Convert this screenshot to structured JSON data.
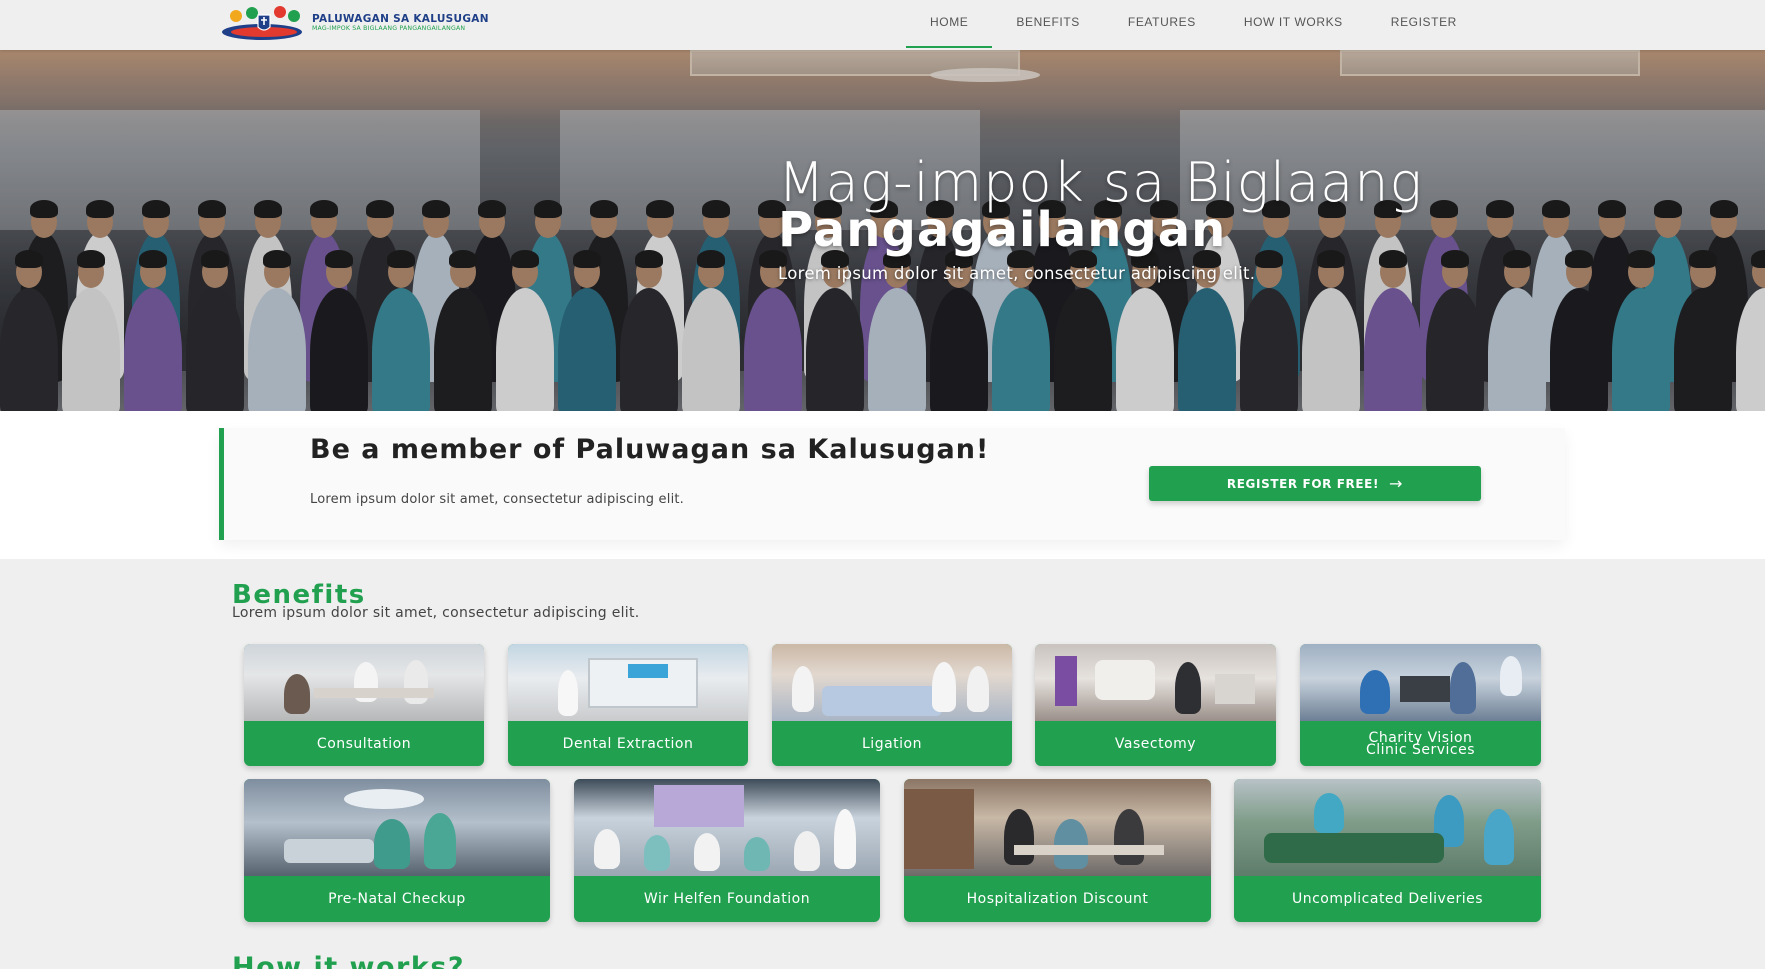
{
  "brand": {
    "name": "PALUWAGAN SA KALUSUGAN",
    "tagline": "MAG-IMPOK SA BIGLAANG PANGANGAILANGAN",
    "primary_color": "#21a04f",
    "dark_blue": "#1f3f88"
  },
  "nav": {
    "items": [
      {
        "label": "HOME",
        "active": true
      },
      {
        "label": "BENEFITS",
        "active": false
      },
      {
        "label": "FEATURES",
        "active": false
      },
      {
        "label": "HOW IT WORKS",
        "active": false
      },
      {
        "label": "REGISTER",
        "active": false
      }
    ]
  },
  "hero": {
    "title_line1": "Mag-impok sa Biglaang",
    "title_line2": "Pangagailangan",
    "subtitle": "Lorem ipsum dolor sit amet, consectetur adipiscing elit."
  },
  "member": {
    "title": "Be a member of Paluwagan sa Kalusugan!",
    "subtitle": "Lorem ipsum dolor sit amet, consectetur adipiscing elit.",
    "button_label": "REGISTER FOR FREE!",
    "button_icon": "arrow-right-icon"
  },
  "benefits": {
    "title": "Benefits",
    "subtitle": "Lorem ipsum dolor sit amet, consectetur adipiscing elit.",
    "row1": [
      {
        "label": "Consultation",
        "photo": "consultation-photo"
      },
      {
        "label": "Dental Extraction",
        "photo": "dental-photo"
      },
      {
        "label": "Ligation",
        "photo": "ligation-photo"
      },
      {
        "label": "Vasectomy",
        "photo": "vasectomy-photo"
      },
      {
        "label": "Charity Vision Clinic Services",
        "photo": "vision-photo"
      }
    ],
    "row2": [
      {
        "label": "Pre-Natal Checkup",
        "photo": "prenatal-photo"
      },
      {
        "label": "Wir Helfen Foundation",
        "photo": "foundation-photo"
      },
      {
        "label": "Hospitalization Discount",
        "photo": "hospitalization-photo"
      },
      {
        "label": "Uncomplicated Deliveries",
        "photo": "deliveries-photo"
      }
    ]
  },
  "how_it_works": {
    "title": "How it works?"
  }
}
